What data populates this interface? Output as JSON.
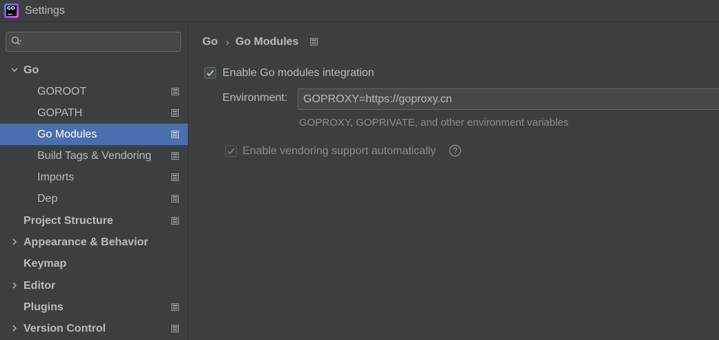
{
  "window": {
    "title": "Settings",
    "app_icon_text": "GO"
  },
  "search": {
    "value": "",
    "placeholder": ""
  },
  "sidebar": {
    "items": [
      {
        "label": "Go",
        "bold": true,
        "expandable": true,
        "expanded": true,
        "page_icon": false
      },
      {
        "label": "GOROOT",
        "bold": false,
        "expandable": false,
        "page_icon": true
      },
      {
        "label": "GOPATH",
        "bold": false,
        "expandable": false,
        "page_icon": true
      },
      {
        "label": "Go Modules",
        "bold": false,
        "expandable": false,
        "page_icon": true,
        "selected": true
      },
      {
        "label": "Build Tags & Vendoring",
        "bold": false,
        "expandable": false,
        "page_icon": true
      },
      {
        "label": "Imports",
        "bold": false,
        "expandable": false,
        "page_icon": true
      },
      {
        "label": "Dep",
        "bold": false,
        "expandable": false,
        "page_icon": true
      },
      {
        "label": "Project Structure",
        "bold": true,
        "expandable": false,
        "page_icon": true
      },
      {
        "label": "Appearance & Behavior",
        "bold": true,
        "expandable": true,
        "expanded": false,
        "page_icon": false
      },
      {
        "label": "Keymap",
        "bold": true,
        "expandable": false,
        "page_icon": false
      },
      {
        "label": "Editor",
        "bold": true,
        "expandable": true,
        "expanded": false,
        "page_icon": false
      },
      {
        "label": "Plugins",
        "bold": true,
        "expandable": false,
        "page_icon": true
      },
      {
        "label": "Version Control",
        "bold": true,
        "expandable": true,
        "expanded": false,
        "page_icon": true
      }
    ]
  },
  "content": {
    "breadcrumb": {
      "parent": "Go",
      "current": "Go Modules"
    },
    "enable_modules": {
      "label": "Enable Go modules integration",
      "checked": true
    },
    "environment": {
      "label": "Environment:",
      "value": "GOPROXY=https://goproxy.cn",
      "hint": "GOPROXY, GOPRIVATE, and other environment variables"
    },
    "enable_vendoring": {
      "label": "Enable vendoring support automatically",
      "checked": true,
      "disabled": true
    }
  },
  "colors": {
    "background": "#3c3f41",
    "selection": "#4b6eaf",
    "text": "#bbbbbb",
    "hint_text": "#8c8c8c"
  }
}
